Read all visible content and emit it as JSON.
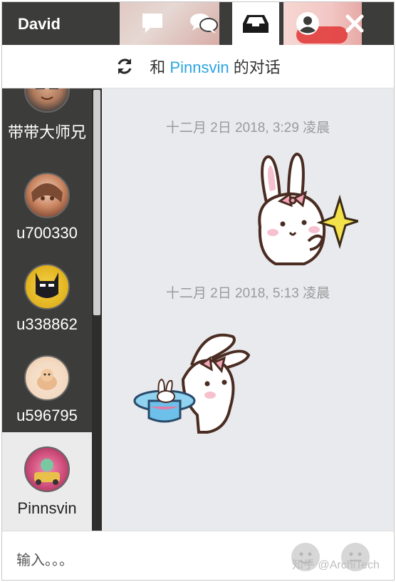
{
  "header": {
    "user_name": "David",
    "tabs": [
      {
        "icon": "message-icon"
      },
      {
        "icon": "chat-bubbles-icon"
      },
      {
        "icon": "inbox-icon"
      },
      {
        "icon": "user-icon"
      },
      {
        "icon": "close-icon"
      }
    ],
    "active_tab": "inbox-icon"
  },
  "conversation": {
    "prefix": "和",
    "name": "Pinnsvin",
    "suffix": "的对话",
    "refresh_icon": "refresh-icon"
  },
  "contacts": [
    {
      "name": "带带大师兄"
    },
    {
      "name": "u700330"
    },
    {
      "name": "u338862"
    },
    {
      "name": "u596795"
    },
    {
      "name": "Pinnsvin",
      "active": true
    }
  ],
  "messages": [
    {
      "timestamp": "十二月 2日 2018, 3:29 凌晨",
      "sticker": "bunny-star-sticker",
      "side": "right"
    },
    {
      "timestamp": "十二月 2日 2018, 5:13 凌晨",
      "sticker": "bunny-hat-sticker",
      "side": "left"
    }
  ],
  "input": {
    "placeholder": "输入。。。"
  },
  "watermark": "知乎 @ArchiTech",
  "colors": {
    "header_bg": "#3c3d3b",
    "accent": "#2ba5e0",
    "chat_bg": "#e8eaed"
  }
}
